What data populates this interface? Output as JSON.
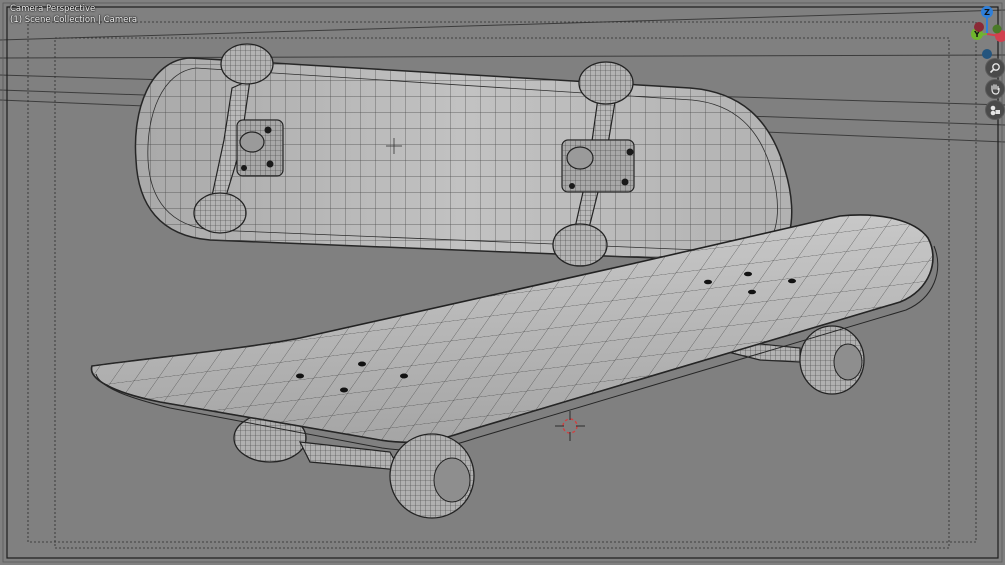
{
  "viewport": {
    "view_name": "Camera Perspective",
    "collection_path": "(1) Scene Collection | Camera"
  },
  "gizmo": {
    "axes": [
      {
        "label": "Z",
        "color": "#2f7fd9"
      },
      {
        "label": "Y",
        "color": "#6fb52d"
      },
      {
        "label": "X",
        "color": "#d2404f"
      }
    ]
  },
  "nav_buttons": [
    {
      "icon": "zoom-magnifier-icon"
    },
    {
      "icon": "pan-hand-icon"
    },
    {
      "icon": "camera-view-icon"
    }
  ],
  "colors": {
    "viewport_bg": "#808080",
    "camera_frame": "#1c1c1c",
    "mesh_fill": "#b4b4b4",
    "wire": "#3a3a3a"
  }
}
